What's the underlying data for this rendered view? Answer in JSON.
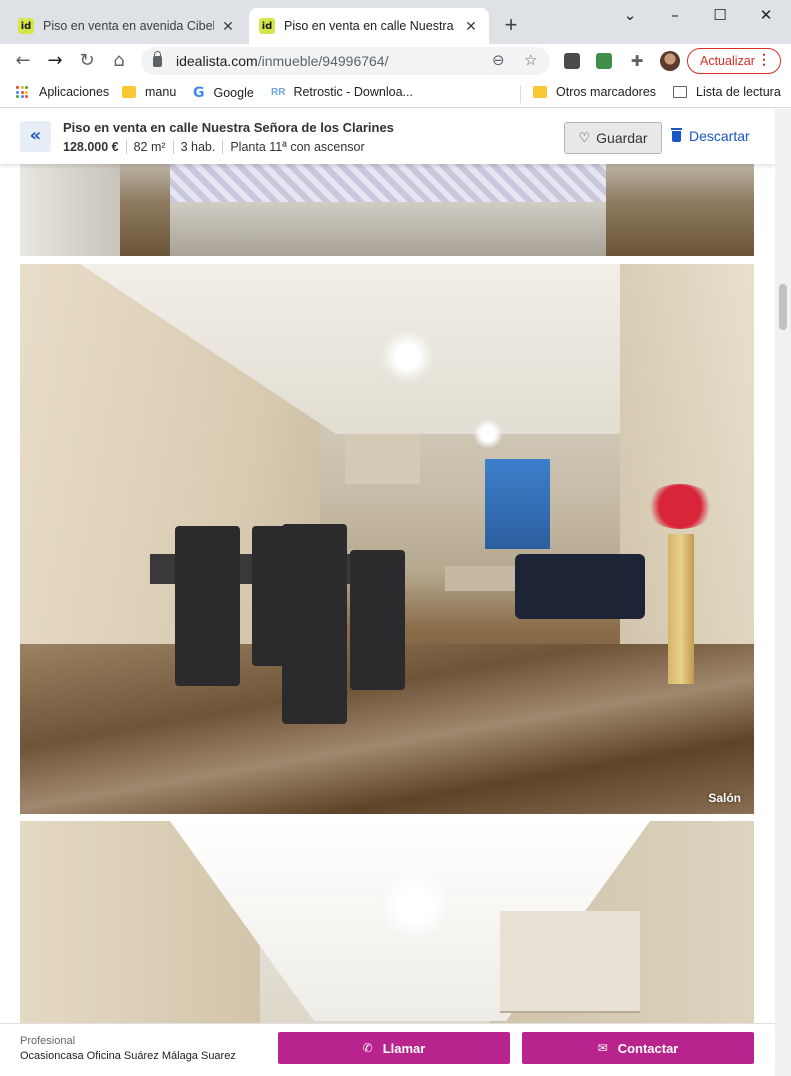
{
  "browser": {
    "tabs": [
      {
        "favicon": "id",
        "title": "Piso en venta en avenida Cibeles",
        "active": false
      },
      {
        "favicon": "id",
        "title": "Piso en venta en calle Nuestra Se",
        "active": true
      }
    ],
    "url_host": "idealista.com",
    "url_path": "/inmueble/94996764/",
    "update_label": "Actualizar",
    "bookmarks": [
      "Aplicaciones",
      "manu",
      "Google",
      "Retrostic - Downloa...",
      "Otros marcadores",
      "Lista de lectura"
    ],
    "icons": {
      "back": "arrow-left-icon",
      "forward": "arrow-right-icon",
      "reload": "reload-icon",
      "home": "home-icon",
      "zoom": "zoom-icon",
      "star": "star-icon",
      "extensions": "puzzle-icon"
    }
  },
  "listing": {
    "title": "Piso en venta en calle Nuestra Señora de los Clarines",
    "price": "128.000 €",
    "size": "82 m²",
    "rooms": "3 hab.",
    "floor": "Planta 11ª con ascensor",
    "save_label": "Guardar",
    "discard_label": "Descartar"
  },
  "gallery": {
    "photo2_caption": "Salón"
  },
  "contact": {
    "type_label": "Profesional",
    "agency": "Ocasioncasa Oficina Suárez Málaga Suarez",
    "call_label": "Llamar",
    "contact_label": "Contactar"
  },
  "colors": {
    "accent_blue": "#1a56c4",
    "cta_magenta": "#b8238d",
    "update_red": "#d93025"
  }
}
